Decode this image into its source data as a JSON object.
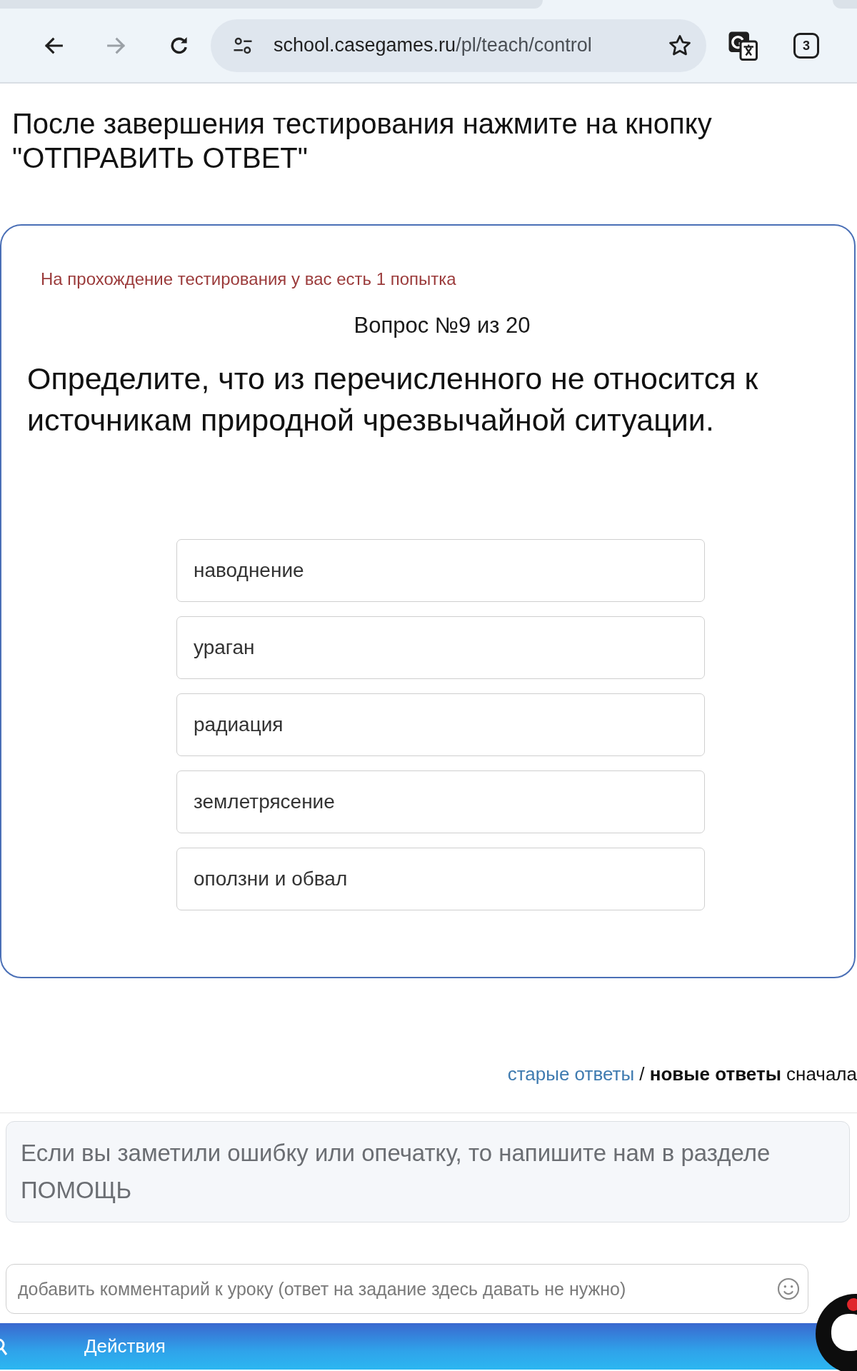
{
  "browser": {
    "navigation": [
      {
        "kind": "back",
        "disabled": false
      },
      {
        "kind": "forward",
        "disabled": true
      },
      {
        "kind": "reload",
        "disabled": false
      }
    ],
    "url_host": "school.casegames.ru",
    "url_path": "/pl/teach/control",
    "tab_count": "3"
  },
  "instruction": "После завершения тестирования нажмите на кнопку \"ОТПРАВИТЬ ОТВЕТ\"",
  "quiz": {
    "attempts_note": "На прохождение тестирования у вас есть 1 попытка",
    "progress": "Вопрос №9 из 20",
    "question": "Определите, что из перечисленного не относится к источникам природной чрезвычайной ситуации.",
    "options": [
      {
        "label": "наводнение",
        "selected": false
      },
      {
        "label": "ураган",
        "selected": false
      },
      {
        "label": "радиация",
        "selected": false
      },
      {
        "label": "землетрясение",
        "selected": false
      },
      {
        "label": "оползни и обвал",
        "selected": false
      }
    ]
  },
  "comments": {
    "sort_options": [
      {
        "label": "старые ответы",
        "selected": false
      },
      {
        "label": "новые ответы",
        "selected": true
      }
    ],
    "separator": "/",
    "sort_suffix": "сначала",
    "notice": "Если вы заметили ошибку или опечатку, то напишите нам в разделе ПОМОЩЬ",
    "comment_field": {
      "placeholder": "добавить комментарий к уроку (ответ на задание здесь давать не нужно)"
    }
  },
  "bottom_bar": {
    "label": "Действия"
  }
}
